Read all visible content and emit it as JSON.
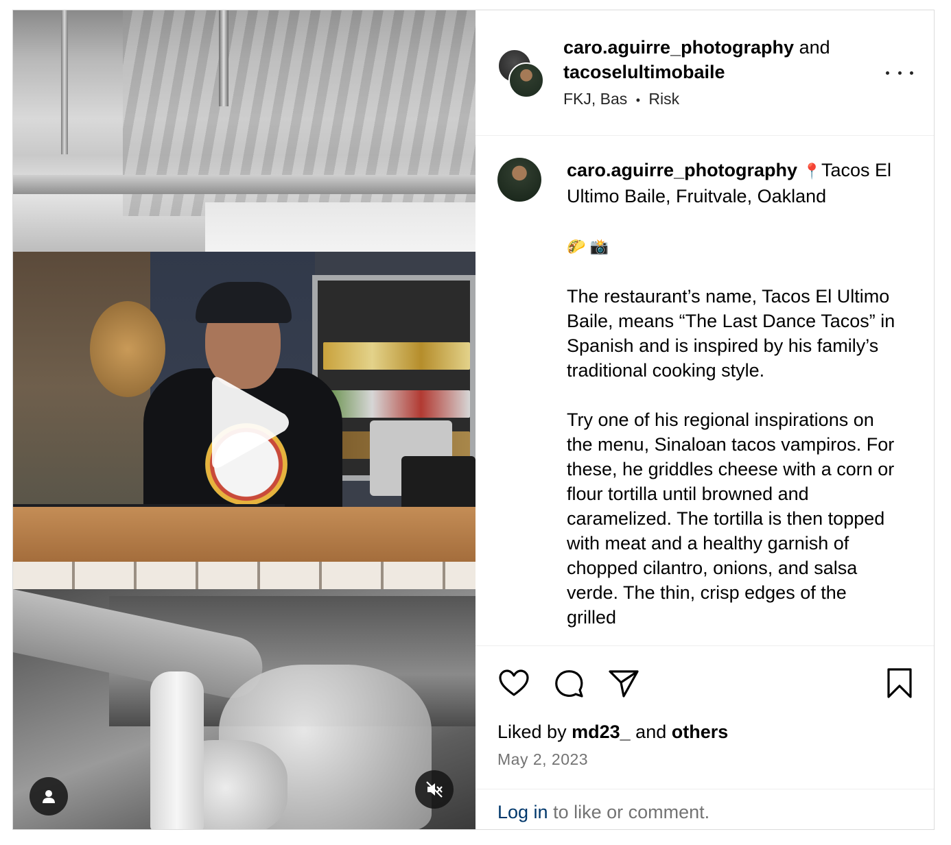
{
  "post": {
    "author": "caro.aguirre_photography",
    "and_text": "and",
    "collaborator": "tacoselultimobaile",
    "audio": "FKJ, Bas",
    "audio_sep": "•",
    "audio_track": "Risk"
  },
  "caption": {
    "username": "caro.aguirre_photography",
    "location_pin": "📍",
    "line1": "Tacos El Ultimo Baile, Fruitvale, Oakland",
    "emojis": "🌮 📸",
    "body": "The restaurant’s name, Tacos El Ultimo Baile, means “The Last Dance Tacos” in Spanish and is inspired by his family’s traditional cooking style.\n\nTry one of his regional inspirations on the menu, Sinaloan tacos vampiros. For these, he griddles cheese with a corn or flour tortilla until browned and caramelized. The tortilla is then topped with meat and a healthy garnish of chopped cilantro, onions, and salsa verde. The thin, crisp edges of the grilled"
  },
  "engagement": {
    "liked_by_prefix": "Liked by",
    "liked_by_user": "md23_",
    "liked_by_and": "and",
    "liked_by_others": "others",
    "date": "May 2, 2023"
  },
  "login": {
    "link": "Log in",
    "rest": "to like or comment."
  },
  "icons": [
    "like-heart-icon",
    "comment-icon",
    "share-icon",
    "save-bookmark-icon",
    "more-options-icon",
    "play-icon",
    "user-tags-icon",
    "mute-icon"
  ]
}
